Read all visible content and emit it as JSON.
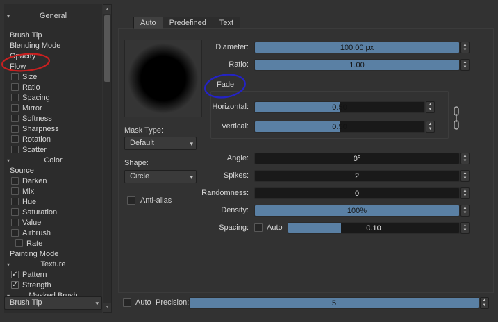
{
  "colors": {
    "accent_fill": "#5a80a4",
    "annotation_red": "#c92020",
    "annotation_blue": "#2423c4"
  },
  "icons": {
    "check": "✓",
    "dropdown_arrow": "▾",
    "header_arrow": "▾",
    "spin_up": "▲",
    "spin_down": "▼",
    "scroll_up": "▲",
    "scroll_down": "▼"
  },
  "sidebar": {
    "items": [
      {
        "label": "General",
        "type": "header"
      },
      {
        "label": "Brush Tip",
        "type": "item"
      },
      {
        "label": "Blending Mode",
        "type": "item"
      },
      {
        "label": "Opacity",
        "type": "item"
      },
      {
        "label": "Flow",
        "type": "item"
      },
      {
        "label": "Size",
        "type": "checkbox",
        "checked": false
      },
      {
        "label": "Ratio",
        "type": "checkbox",
        "checked": false
      },
      {
        "label": "Spacing",
        "type": "checkbox",
        "checked": false
      },
      {
        "label": "Mirror",
        "type": "checkbox",
        "checked": false
      },
      {
        "label": "Softness",
        "type": "checkbox",
        "checked": false
      },
      {
        "label": "Sharpness",
        "type": "checkbox",
        "checked": false
      },
      {
        "label": "Rotation",
        "type": "checkbox",
        "checked": false
      },
      {
        "label": "Scatter",
        "type": "checkbox",
        "checked": false
      },
      {
        "label": "Color",
        "type": "header"
      },
      {
        "label": "Source",
        "type": "item"
      },
      {
        "label": "Darken",
        "type": "checkbox",
        "checked": false
      },
      {
        "label": "Mix",
        "type": "checkbox",
        "checked": false
      },
      {
        "label": "Hue",
        "type": "checkbox",
        "checked": false
      },
      {
        "label": "Saturation",
        "type": "checkbox",
        "checked": false
      },
      {
        "label": "Value",
        "type": "checkbox",
        "checked": false
      },
      {
        "label": "Airbrush",
        "type": "checkbox",
        "checked": false
      },
      {
        "label": "Rate",
        "type": "checkbox",
        "checked": false,
        "indent": true
      },
      {
        "label": "Painting Mode",
        "type": "item"
      },
      {
        "label": "Texture",
        "type": "header"
      },
      {
        "label": "Pattern",
        "type": "checkbox",
        "checked": true
      },
      {
        "label": "Strength",
        "type": "checkbox",
        "checked": true
      },
      {
        "label": "Masked Brush",
        "type": "header"
      },
      {
        "label": "Brush Tip",
        "type": "combo"
      }
    ]
  },
  "tabs": {
    "items": [
      {
        "label": "Auto",
        "active": true
      },
      {
        "label": "Predefined",
        "active": false
      },
      {
        "label": "Text",
        "active": false
      }
    ]
  },
  "left_controls": {
    "mask_type_label": "Mask Type:",
    "mask_type_value": "Default",
    "shape_label": "Shape:",
    "shape_value": "Circle",
    "antialias_label": "Anti-alias",
    "antialias_checked": false
  },
  "fade": {
    "label": "Fade"
  },
  "sliders": {
    "diameter": {
      "label": "Diameter:",
      "value": "100.00 px",
      "fill": 100
    },
    "ratio": {
      "label": "Ratio:",
      "value": "1.00",
      "fill": 100
    },
    "horizontal": {
      "label": "Horizontal:",
      "value": "0.50",
      "fill": 50
    },
    "vertical": {
      "label": "Vertical:",
      "value": "0.50",
      "fill": 50
    },
    "angle": {
      "label": "Angle:",
      "value": "0°",
      "fill": 0
    },
    "spikes": {
      "label": "Spikes:",
      "value": "2",
      "fill": 0
    },
    "randomness": {
      "label": "Randomness:",
      "value": "0",
      "fill": 0
    },
    "density": {
      "label": "Density:",
      "value": "100%",
      "fill": 100
    },
    "spacing": {
      "label": "Spacing:",
      "auto_label": "Auto",
      "auto_checked": false,
      "value": "0.10",
      "fill": 31
    },
    "precision": {
      "label": "Precision:",
      "auto_label": "Auto",
      "auto_checked": false,
      "value": "5",
      "fill": 100
    }
  }
}
